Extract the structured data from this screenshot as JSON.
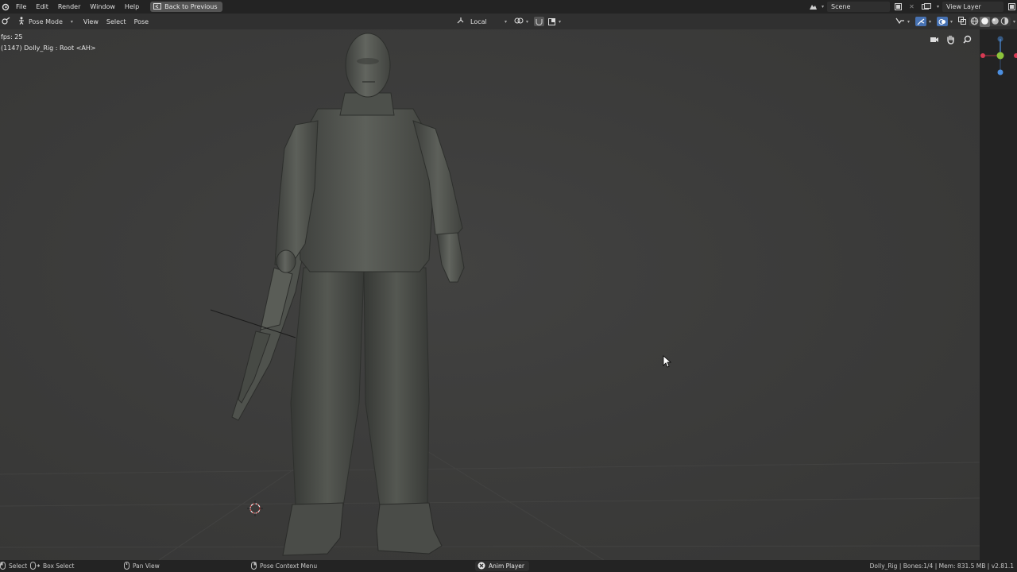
{
  "topbar": {
    "menus": [
      "File",
      "Edit",
      "Render",
      "Window",
      "Help"
    ],
    "back_button": "Back to Previous",
    "scene": "Scene",
    "view_layer": "View Layer"
  },
  "viewport_header": {
    "mode": "Pose Mode",
    "menus": [
      "View",
      "Select",
      "Pose"
    ],
    "transform_orientation": "Local"
  },
  "viewport": {
    "fps": "fps: 25",
    "object_info": "(1147) Dolly_Rig : Root <AH>"
  },
  "statusbar": {
    "select": "Select",
    "box_select": "Box Select",
    "pan_view": "Pan View",
    "context_menu": "Pose Context Menu",
    "anim_player": "Anim Player",
    "stats": "Dolly_Rig | Bones:1/4 | Mem: 831.5 MB | v2.81.1"
  },
  "colors": {
    "axis_x": "#d73a53",
    "axis_y": "#8dc43b",
    "axis_z": "#4c8fe0"
  }
}
